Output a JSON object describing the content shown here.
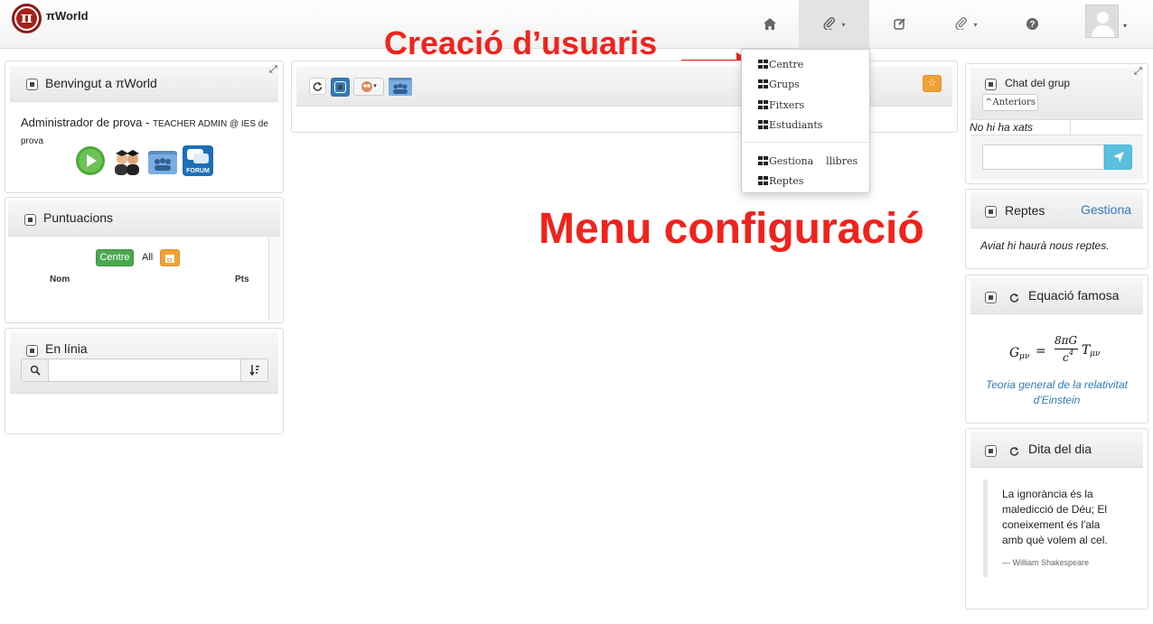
{
  "navbar": {
    "brand": "πWorld",
    "logo_letter": "π",
    "items": [
      {
        "icon": "home-icon",
        "glyph": "⌂"
      },
      {
        "icon": "paperclip-icon",
        "glyph": "⊘",
        "caret": "▾"
      },
      {
        "icon": "edit-icon",
        "glyph": "☑"
      },
      {
        "icon": "paperclip-icon-2",
        "glyph": "⊘",
        "caret": "▾"
      },
      {
        "icon": "help-icon",
        "glyph": "?"
      }
    ],
    "avatar_caret": "▾"
  },
  "dropdown": {
    "items": [
      "Centre",
      "Grups",
      "Fitxers",
      "Estudiants"
    ],
    "items2": [
      "Gestiona    llibres",
      "Reptes"
    ]
  },
  "annotations": {
    "user_creation": "Creació d’usuaris",
    "config_menu": "Menu configuració",
    "colors": {
      "red": "#f0231c"
    }
  },
  "welcome": {
    "title": "Benvingut a πWorld",
    "user_role": "Administrador de prova - ",
    "user_detail": "TEACHER ADMIN @ IES de prova",
    "forum_label": "FORUM"
  },
  "scores": {
    "title": "Puntuacions",
    "filter_centre": "Centre",
    "filter_all": "All",
    "col_name": "Nom",
    "col_pts": "Pts"
  },
  "online": {
    "title": "En línia",
    "search_value": ""
  },
  "center_toolbar": {
    "star": "☆"
  },
  "chat": {
    "title": "Chat del grup",
    "previous_button": "Anteriors",
    "empty_text": "No hi ha xats",
    "input_value": ""
  },
  "challenges": {
    "title": "Reptes",
    "manage_link": "Gestiona",
    "text": "Aviat hi haurà nous reptes."
  },
  "equation": {
    "title": "Equació famosa",
    "lhs": "G",
    "lhs_sub": "μν",
    "eq": "=",
    "num": "8πG",
    "den": "c",
    "den_sup": "4",
    "rhs": "T",
    "rhs_sub": "μν",
    "caption": "Teoria general de la relativitat d'Einstein"
  },
  "quote": {
    "title": "Dita del dia",
    "text": "La ignorància és la maledicció de Déu; El coneixement és l'ala amb què volem al cel.",
    "author": "— William Shakespeare"
  }
}
